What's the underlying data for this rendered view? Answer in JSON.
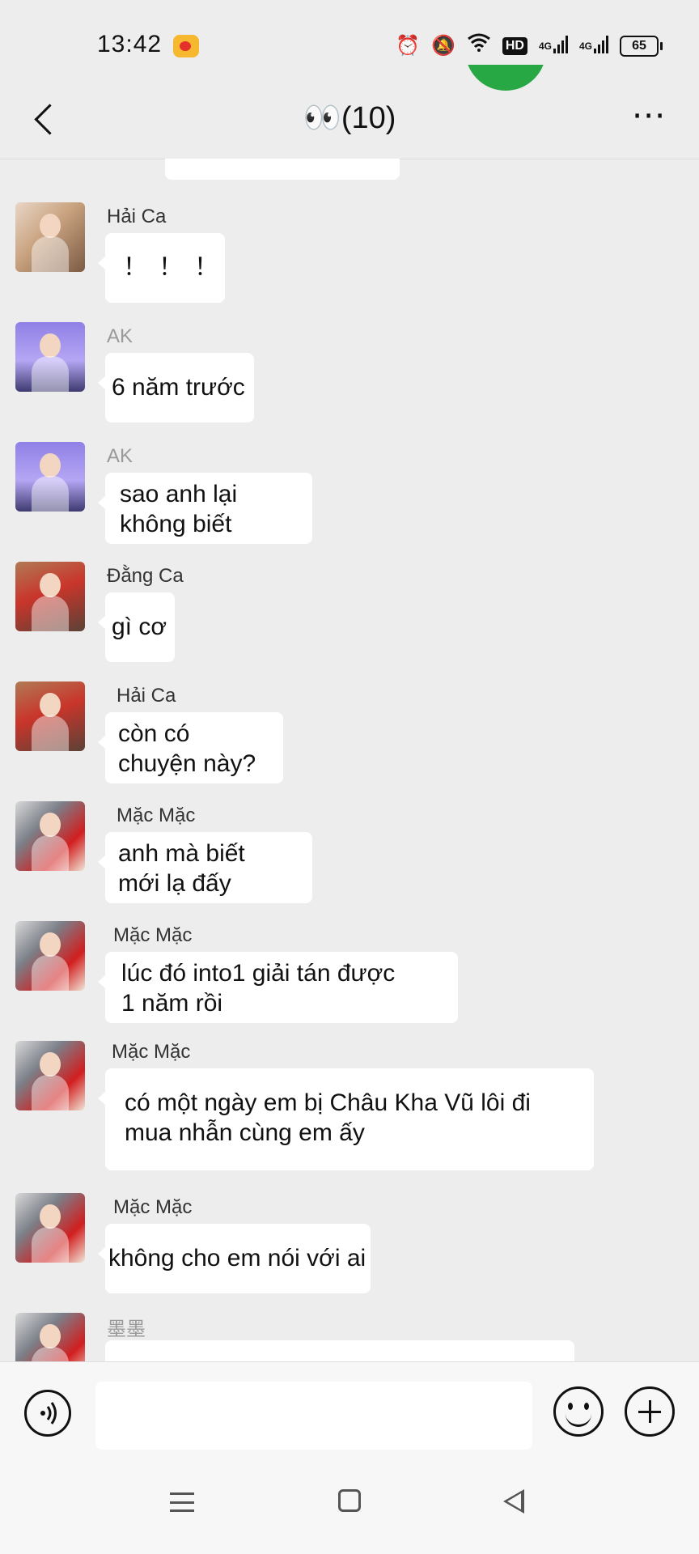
{
  "status_bar": {
    "time": "13:42",
    "battery": "65",
    "hd_badge": "HD",
    "network_1": "4G",
    "network_2": "4G",
    "icons": [
      "weibo-icon",
      "alarm-icon",
      "mute-bell-icon",
      "wifi-icon",
      "signal-icon",
      "battery-icon"
    ]
  },
  "header": {
    "title": "👀(10)",
    "back_icon": "chevron-left-icon",
    "more_label": "⋯"
  },
  "messages": [
    {
      "sender": "Hải Ca",
      "text": "！！！",
      "avatar": "haica"
    },
    {
      "sender": "AK",
      "text": "6 năm trước",
      "avatar": "ak"
    },
    {
      "sender": "AK",
      "text": "sao anh lại\nkhông biết",
      "avatar": "ak"
    },
    {
      "sender": "Đằng Ca",
      "text": "gì cơ",
      "avatar": "dang"
    },
    {
      "sender": "Hải Ca",
      "text": "còn có\nchuyện này?",
      "avatar": "dang"
    },
    {
      "sender": "Mặc Mặc",
      "text": "anh mà biết\nmới lạ đấy",
      "avatar": "mac"
    },
    {
      "sender": "Mặc Mặc",
      "text": "lúc đó into1 giải tán được\n1 năm rồi",
      "avatar": "mac"
    },
    {
      "sender": "Mặc Mặc",
      "text": "có một ngày em bị Châu Kha Vũ lôi đi\nmua nhẫn cùng em ấy",
      "avatar": "mac"
    },
    {
      "sender": "Mặc Mặc",
      "text": "không cho em nói với ai",
      "avatar": "mac"
    },
    {
      "sender": "墨墨",
      "text": "",
      "avatar": "mac"
    }
  ],
  "input_bar": {
    "value": "",
    "icons": [
      "voice-icon",
      "emoji-icon",
      "plus-icon"
    ]
  },
  "system_nav": {
    "icons": [
      "menu-icon",
      "home-icon",
      "back-triangle-icon"
    ]
  },
  "colors": {
    "background": "#ededed",
    "bubble": "#ffffff",
    "accent_green": "#27a845"
  }
}
